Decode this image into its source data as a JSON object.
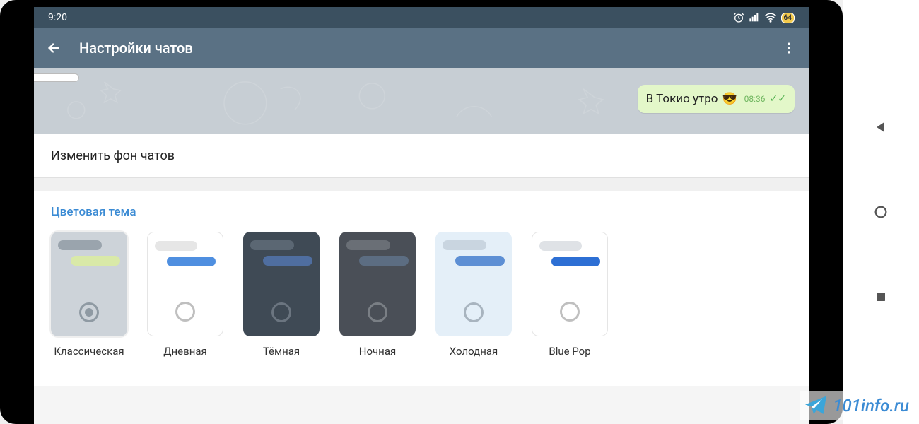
{
  "statusbar": {
    "time": "9:20",
    "battery": "64"
  },
  "appbar": {
    "title": "Настройки чатов"
  },
  "preview": {
    "message": "В Токио утро",
    "emoji": "😎",
    "time": "08:36"
  },
  "sections": {
    "change_background": "Изменить фон чатов",
    "color_theme_header": "Цветовая тема"
  },
  "themes": [
    {
      "label": "Классическая",
      "card_bg": "#cdd3d9",
      "in": "#9aa4ad",
      "out": "#d9e9a8",
      "ring": "#8f9aa3",
      "selected": true
    },
    {
      "label": "Дневная",
      "card_bg": "#ffffff",
      "in": "#e6e6e6",
      "out": "#4f8fe0",
      "ring": "#bfbfbf",
      "selected": false,
      "border": "#e5e5e5"
    },
    {
      "label": "Тёмная",
      "card_bg": "#3f4a55",
      "in": "#5b6773",
      "out": "#4f6ea0",
      "ring": "#6b7580",
      "selected": false
    },
    {
      "label": "Ночная",
      "card_bg": "#4a4f57",
      "in": "#6a6f76",
      "out": "#5c6d82",
      "ring": "#7a7f85",
      "selected": false
    },
    {
      "label": "Холодная",
      "card_bg": "#e4eff8",
      "in": "#c9d5e0",
      "out": "#5d8fd4",
      "ring": "#a8b4bf",
      "selected": false
    },
    {
      "label": "Blue Pop",
      "card_bg": "#ffffff",
      "in": "#dfe2e6",
      "out": "#2d6fd4",
      "ring": "#bfbfbf",
      "selected": false,
      "border": "#e5e5e5"
    }
  ],
  "watermark": "101info.ru"
}
